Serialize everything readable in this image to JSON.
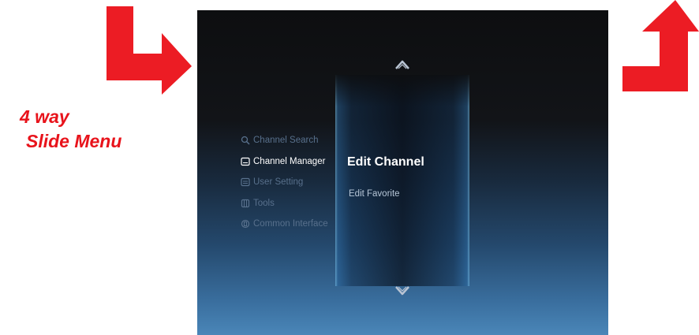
{
  "caption": {
    "line1": "4 way",
    "line2": "Slide Menu",
    "color": "#e8131b"
  },
  "screen": {
    "menu": [
      {
        "label": "Channel Search",
        "icon": "magnifier-icon",
        "active": false
      },
      {
        "label": "Channel Manager",
        "icon": "channel-manager-icon",
        "active": true
      },
      {
        "label": "User Setting",
        "icon": "user-setting-icon",
        "active": false
      },
      {
        "label": "Tools",
        "icon": "tools-icon",
        "active": false
      },
      {
        "label": "Common Interface",
        "icon": "common-interface-icon",
        "active": false
      }
    ],
    "submenu": {
      "title": "Edit Channel",
      "items": [
        "Edit Favorite"
      ]
    },
    "nav": {
      "up": "chevron-up-icon",
      "down": "chevron-down-icon"
    }
  }
}
